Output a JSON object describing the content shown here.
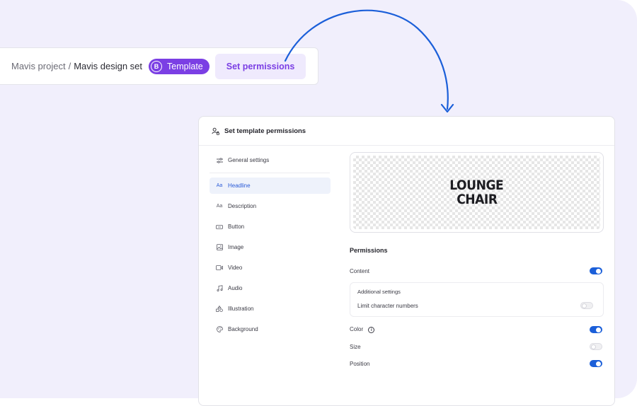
{
  "breadcrumb": {
    "project": "Mavis project",
    "separator": "/",
    "current": "Mavis design set",
    "badge_icon_letter": "B",
    "badge_label": "Template",
    "action_label": "Set permissions"
  },
  "panel": {
    "title": "Set template permissions",
    "nav": [
      {
        "label": "General settings",
        "icon": "sliders-icon"
      },
      {
        "label": "Headline",
        "icon": "text-icon",
        "glyph": "Aa",
        "active": true
      },
      {
        "label": "Description",
        "icon": "text-icon",
        "glyph": "Aa"
      },
      {
        "label": "Button",
        "icon": "button-icon"
      },
      {
        "label": "Image",
        "icon": "image-icon"
      },
      {
        "label": "Video",
        "icon": "video-icon"
      },
      {
        "label": "Audio",
        "icon": "music-icon"
      },
      {
        "label": "Illustration",
        "icon": "shapes-icon"
      },
      {
        "label": "Background",
        "icon": "palette-icon"
      }
    ],
    "preview": {
      "line1": "LOUNGE",
      "line2": "CHAIR"
    },
    "permissions": {
      "title": "Permissions",
      "content": {
        "label": "Content",
        "on": true
      },
      "additional": {
        "title": "Additional settings",
        "limit_label": "Limit character numbers",
        "limit_on": false
      },
      "color": {
        "label": "Color",
        "on": true,
        "info_glyph": "i"
      },
      "size": {
        "label": "Size",
        "on": false
      },
      "position": {
        "label": "Position",
        "on": true
      }
    }
  },
  "colors": {
    "accent": "#7b3fe4",
    "toggle_on": "#1b5fd9",
    "arrow": "#1b5fd9",
    "background": "#f1effc"
  }
}
